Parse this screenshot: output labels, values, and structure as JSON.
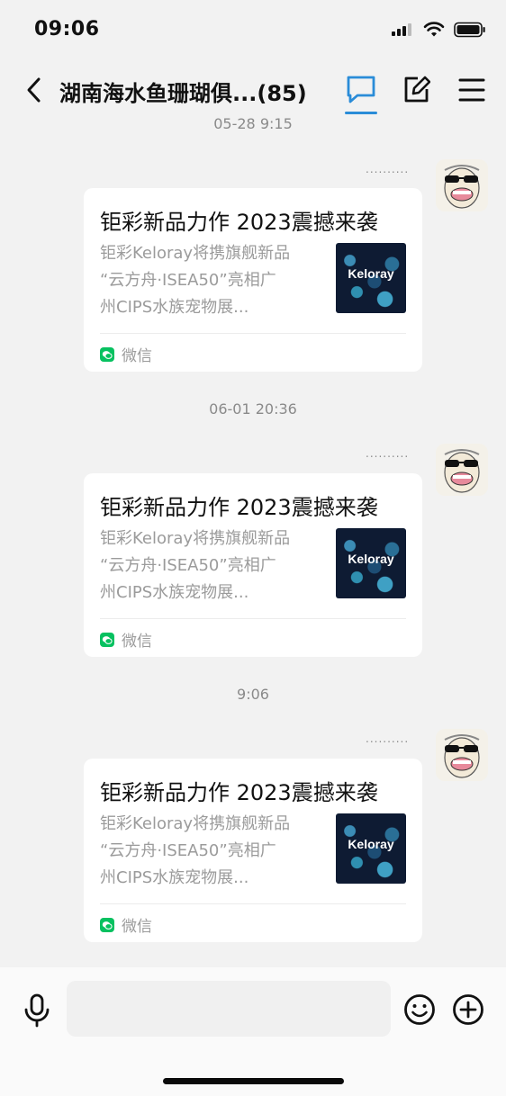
{
  "status_bar": {
    "time": "09:06",
    "icons": [
      "signal-icon",
      "wifi-icon",
      "battery-icon"
    ]
  },
  "nav": {
    "title": "湖南海水鱼珊瑚俱...(85)",
    "icons": [
      "back-icon",
      "chat-icon",
      "edit-icon",
      "menu-icon"
    ],
    "accent_color": "#2a8cd8"
  },
  "messages": [
    {
      "timestamp": "05-28 9:15",
      "status_dots": "..........",
      "card": {
        "title": "钜彩新品力作 2023震撼来袭",
        "description_lines": [
          "钜彩Keloray将携旗舰新品",
          "“云方舟·ISEA50”亮相广",
          "州CIPS水族宠物展..."
        ],
        "thumbnail_brand": "Keloray",
        "source": "微信"
      }
    },
    {
      "timestamp": "06-01 20:36",
      "status_dots": "..........",
      "card": {
        "title": "钜彩新品力作 2023震撼来袭",
        "description_lines": [
          "钜彩Keloray将携旗舰新品",
          "“云方舟·ISEA50”亮相广",
          "州CIPS水族宠物展..."
        ],
        "thumbnail_brand": "Keloray",
        "source": "微信"
      }
    },
    {
      "timestamp": "9:06",
      "status_dots": "..........",
      "card": {
        "title": "钜彩新品力作 2023震撼来袭",
        "description_lines": [
          "钜彩Keloray将携旗舰新品",
          "“云方舟·ISEA50”亮相广",
          "州CIPS水族宠物展..."
        ],
        "thumbnail_brand": "Keloray",
        "source": "微信"
      }
    }
  ],
  "input_bar": {
    "placeholder": "",
    "icons": [
      "microphone-icon",
      "emoji-icon",
      "plus-icon"
    ]
  },
  "colors": {
    "background": "#f2f2f2",
    "wechat_green": "#07c160"
  }
}
